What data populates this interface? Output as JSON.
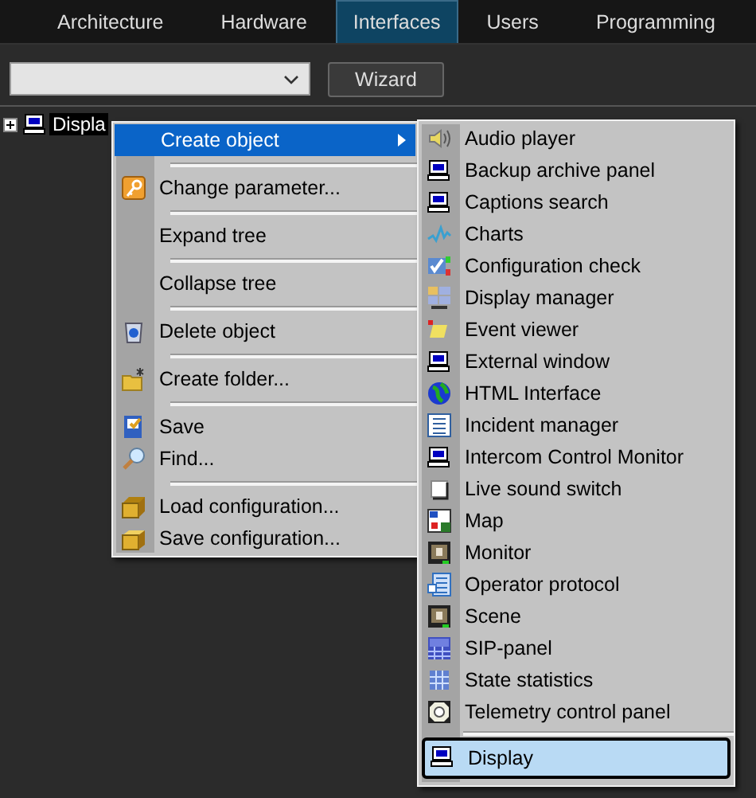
{
  "tabs": [
    {
      "label": "Architecture",
      "selected": false
    },
    {
      "label": "Hardware",
      "selected": false
    },
    {
      "label": "Interfaces",
      "selected": true
    },
    {
      "label": "Users",
      "selected": false
    },
    {
      "label": "Programming",
      "selected": false
    }
  ],
  "toolbar": {
    "wizard_button": "Wizard"
  },
  "tree": [
    {
      "label": "Displa",
      "expanded": false,
      "selected": true
    }
  ],
  "context_menu": {
    "items": [
      {
        "kind": "item",
        "label": "Create object",
        "submenu": true,
        "selected": true
      },
      {
        "kind": "separator"
      },
      {
        "kind": "item",
        "label": "Change parameter...",
        "submenu": false,
        "selected": false
      },
      {
        "kind": "separator"
      },
      {
        "kind": "item",
        "label": "Expand tree",
        "submenu": false,
        "selected": false
      },
      {
        "kind": "separator"
      },
      {
        "kind": "item",
        "label": "Collapse tree",
        "submenu": false,
        "selected": false
      },
      {
        "kind": "separator"
      },
      {
        "kind": "item",
        "label": "Delete object",
        "submenu": false,
        "selected": false
      },
      {
        "kind": "separator"
      },
      {
        "kind": "item",
        "label": "Create folder...",
        "submenu": false,
        "selected": false
      },
      {
        "kind": "separator"
      },
      {
        "kind": "item",
        "label": "Save",
        "submenu": false,
        "selected": false
      },
      {
        "kind": "item",
        "label": "Find...",
        "submenu": false,
        "selected": false
      },
      {
        "kind": "separator"
      },
      {
        "kind": "item",
        "label": "Load configuration...",
        "submenu": false,
        "selected": false
      },
      {
        "kind": "item",
        "label": "Save configuration...",
        "submenu": false,
        "selected": false
      }
    ]
  },
  "submenu": {
    "items": [
      {
        "kind": "item",
        "label": "Audio player",
        "selected": false
      },
      {
        "kind": "item",
        "label": "Backup archive panel",
        "selected": false
      },
      {
        "kind": "item",
        "label": "Captions search",
        "selected": false
      },
      {
        "kind": "item",
        "label": "Charts",
        "selected": false
      },
      {
        "kind": "item",
        "label": "Configuration check",
        "selected": false
      },
      {
        "kind": "item",
        "label": "Display manager",
        "selected": false
      },
      {
        "kind": "item",
        "label": "Event viewer",
        "selected": false
      },
      {
        "kind": "item",
        "label": "External window",
        "selected": false
      },
      {
        "kind": "item",
        "label": "HTML Interface",
        "selected": false
      },
      {
        "kind": "item",
        "label": "Incident manager",
        "selected": false
      },
      {
        "kind": "item",
        "label": "Intercom Control Monitor",
        "selected": false
      },
      {
        "kind": "item",
        "label": "Live sound switch",
        "selected": false
      },
      {
        "kind": "item",
        "label": "Map",
        "selected": false
      },
      {
        "kind": "item",
        "label": "Monitor",
        "selected": false
      },
      {
        "kind": "item",
        "label": "Operator protocol",
        "selected": false
      },
      {
        "kind": "item",
        "label": "Scene",
        "selected": false
      },
      {
        "kind": "item",
        "label": "SIP-panel",
        "selected": false
      },
      {
        "kind": "item",
        "label": "State statistics",
        "selected": false
      },
      {
        "kind": "item",
        "label": "Telemetry control panel",
        "selected": false
      },
      {
        "kind": "separator"
      },
      {
        "kind": "item",
        "label": "Display",
        "selected": true
      }
    ]
  }
}
